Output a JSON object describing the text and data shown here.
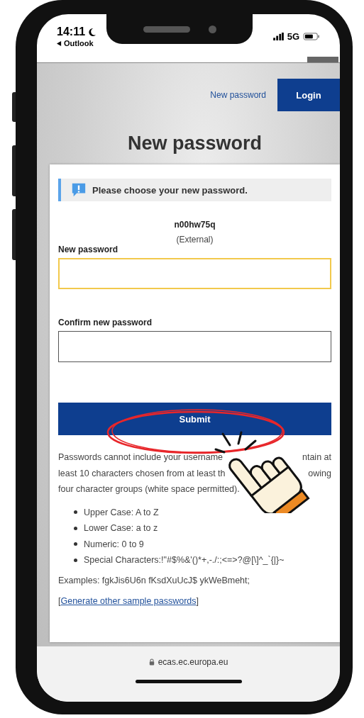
{
  "status_bar": {
    "time": "14:11",
    "back_label": "Outlook",
    "network": "5G"
  },
  "nav": {
    "link": "New password",
    "login_button": "Login"
  },
  "title": "New password",
  "alert": {
    "message": "Please choose your new password."
  },
  "user": {
    "name": "n00hw75q",
    "type": "(External)"
  },
  "fields": [
    {
      "label": "New password",
      "focused": true
    },
    {
      "label": "Confirm new password",
      "focused": false
    }
  ],
  "submit_button": "Submit",
  "rules_text": [
    {
      "left": "Passwords cannot include your username",
      "right": "ntain at"
    },
    {
      "left": "least 10 characters chosen from at least th",
      "right": "owing"
    },
    {
      "left": "four character groups (white space permitted)."
    }
  ],
  "rules": [
    "Upper Case: A to Z",
    "Lower Case: a to z",
    "Numeric: 0 to 9",
    "Special Characters:!\"#$%&'()*+,-./:;<=>?@[\\]^_`{|}~"
  ],
  "examples": "Examples: fgkJis6U6n fKsdXuUcJ$ ykWeBmeht;",
  "generate": {
    "prefix": "[",
    "link": "Generate other sample passwords",
    "suffix": "]"
  },
  "url_bar": {
    "address": "ecas.ec.europa.eu"
  }
}
